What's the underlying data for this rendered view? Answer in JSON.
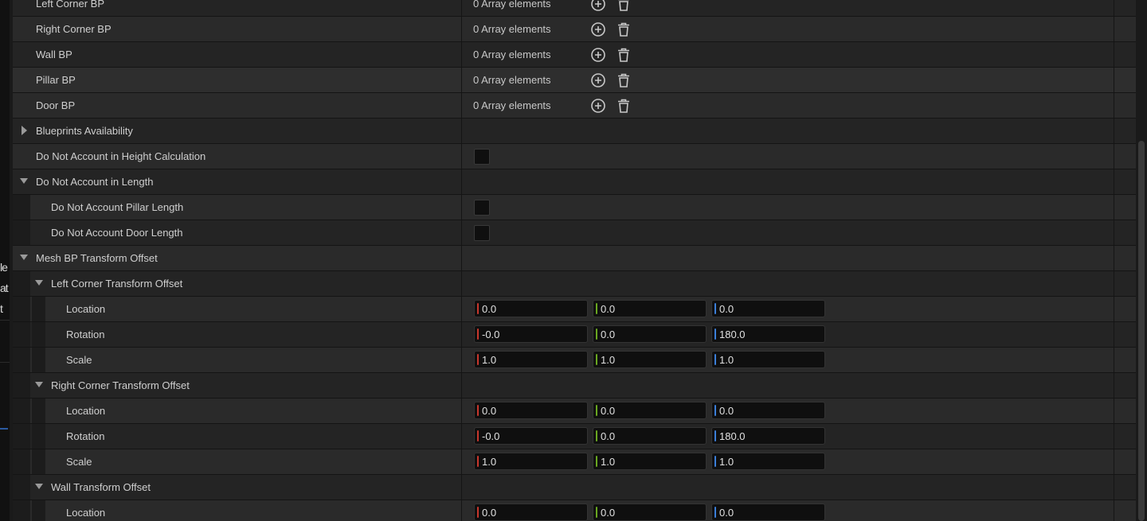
{
  "left_fragments": [
    "le",
    "at",
    "t"
  ],
  "colors": {
    "x_axis": "#c8372d",
    "y_axis": "#6aa820",
    "z_axis": "#3b7fd9"
  },
  "array_rows": [
    {
      "label": "Left Corner BP",
      "value": "0 Array elements"
    },
    {
      "label": "Right Corner BP",
      "value": "0 Array elements"
    },
    {
      "label": "Wall BP",
      "value": "0 Array elements"
    },
    {
      "label": "Pillar BP",
      "value": "0 Array elements"
    },
    {
      "label": "Door BP",
      "value": "0 Array elements"
    }
  ],
  "blueprints_availability": {
    "label": "Blueprints Availability"
  },
  "height_calc": {
    "label": "Do Not Account in Height Calculation"
  },
  "length_group": {
    "label": "Do Not Account in Length",
    "children": [
      {
        "label": "Do Not Account Pillar Length"
      },
      {
        "label": "Do Not Account Door Length"
      }
    ]
  },
  "mesh_offset": {
    "label": "Mesh BP Transform Offset",
    "groups": [
      {
        "label": "Left Corner Transform Offset",
        "rows": [
          {
            "label": "Location",
            "x": "0.0",
            "y": "0.0",
            "z": "0.0"
          },
          {
            "label": "Rotation",
            "x": "-0.0",
            "y": "0.0",
            "z": "180.0"
          },
          {
            "label": "Scale",
            "x": "1.0",
            "y": "1.0",
            "z": "1.0"
          }
        ]
      },
      {
        "label": "Right Corner Transform Offset",
        "rows": [
          {
            "label": "Location",
            "x": "0.0",
            "y": "0.0",
            "z": "0.0"
          },
          {
            "label": "Rotation",
            "x": "-0.0",
            "y": "0.0",
            "z": "180.0"
          },
          {
            "label": "Scale",
            "x": "1.0",
            "y": "1.0",
            "z": "1.0"
          }
        ]
      },
      {
        "label": "Wall Transform Offset",
        "rows": [
          {
            "label": "Location",
            "x": "0.0",
            "y": "0.0",
            "z": "0.0"
          }
        ]
      }
    ]
  }
}
